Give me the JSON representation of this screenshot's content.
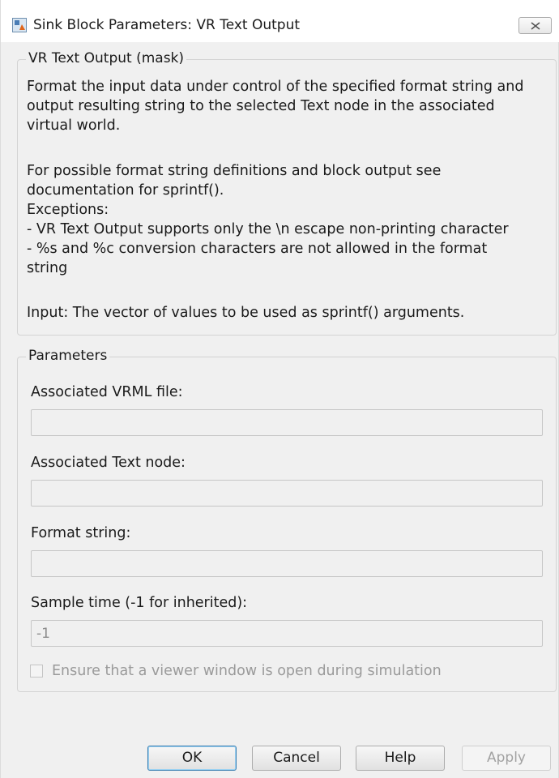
{
  "window": {
    "title": "Sink Block Parameters: VR Text Output",
    "close_icon": "close-icon"
  },
  "description": {
    "group_title": "VR Text Output (mask)",
    "lines": [
      "Format the input data under control of the specified format string and",
      "output resulting string to the selected Text node in the associated",
      "virtual world.",
      "For possible format string definitions and block output see",
      "documentation for sprintf().",
      "Exceptions:",
      " - VR Text Output supports only the \\n escape non-printing character",
      " - %s and %c conversion characters are not allowed in the format",
      "string",
      "Input: The vector of values to be used as sprintf() arguments."
    ]
  },
  "parameters": {
    "group_title": "Parameters",
    "vrml_file": {
      "label": "Associated VRML file:",
      "value": ""
    },
    "text_node": {
      "label": "Associated Text node:",
      "value": ""
    },
    "format_string": {
      "label": "Format string:",
      "value": ""
    },
    "sample_time": {
      "label": "Sample time (-1 for inherited):",
      "value": "-1"
    },
    "viewer_checkbox": {
      "label": "Ensure that a viewer window is open during simulation",
      "checked": false
    }
  },
  "buttons": {
    "ok": "OK",
    "cancel": "Cancel",
    "help": "Help",
    "apply": "Apply"
  },
  "colors": {
    "window_bg": "#f0f0f0",
    "default_button_border": "#3c7fb1",
    "disabled_text": "#9a9a9a"
  }
}
